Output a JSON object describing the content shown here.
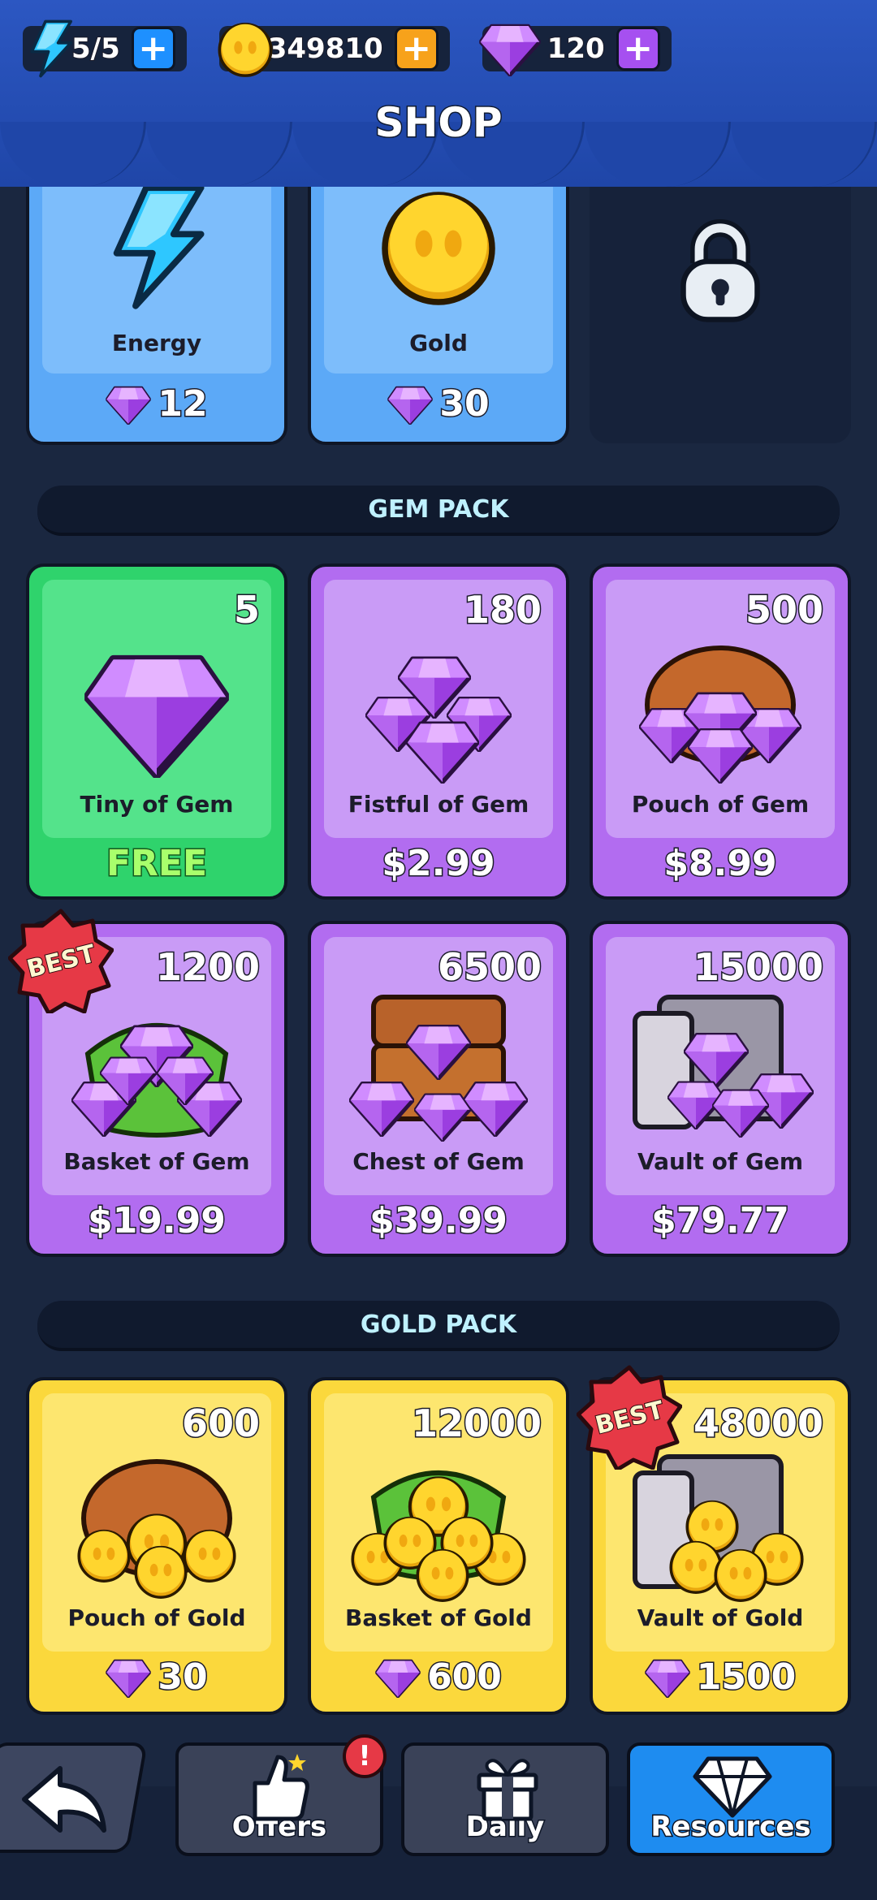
{
  "header": {
    "title": "SHOP",
    "energy": "5/5",
    "gold": "349810",
    "gems": "120"
  },
  "top_items": [
    {
      "label": "Energy",
      "price": "12"
    },
    {
      "label": "Gold",
      "price": "30"
    }
  ],
  "gem_pack": {
    "title": "GEM PACK",
    "items": [
      {
        "amount": "5",
        "label": "Tiny of Gem",
        "price": "FREE"
      },
      {
        "amount": "180",
        "label": "Fistful of Gem",
        "price": "$2.99"
      },
      {
        "amount": "500",
        "label": "Pouch of Gem",
        "price": "$8.99"
      },
      {
        "amount": "1200",
        "label": "Basket of Gem",
        "price": "$19.99",
        "badge": "BEST"
      },
      {
        "amount": "6500",
        "label": "Chest of Gem",
        "price": "$39.99"
      },
      {
        "amount": "15000",
        "label": "Vault of Gem",
        "price": "$79.77"
      }
    ]
  },
  "gold_pack": {
    "title": "GOLD PACK",
    "items": [
      {
        "amount": "600",
        "label": "Pouch of Gold",
        "price": "30"
      },
      {
        "amount": "12000",
        "label": "Basket of Gold",
        "price": "600"
      },
      {
        "amount": "48000",
        "label": "Vault of Gold",
        "price": "1500",
        "badge": "BEST"
      }
    ]
  },
  "nav": {
    "offers": "Offers",
    "offers_alert": "!",
    "daily": "Daily",
    "resources": "Resources"
  },
  "colors": {
    "background": "#1a2740",
    "awning": "#1f46a8",
    "gem_card": "#b26cf0",
    "gold_card": "#fbd83c",
    "free_card": "#2fd36c",
    "resources_tab": "#1e8cf0"
  }
}
